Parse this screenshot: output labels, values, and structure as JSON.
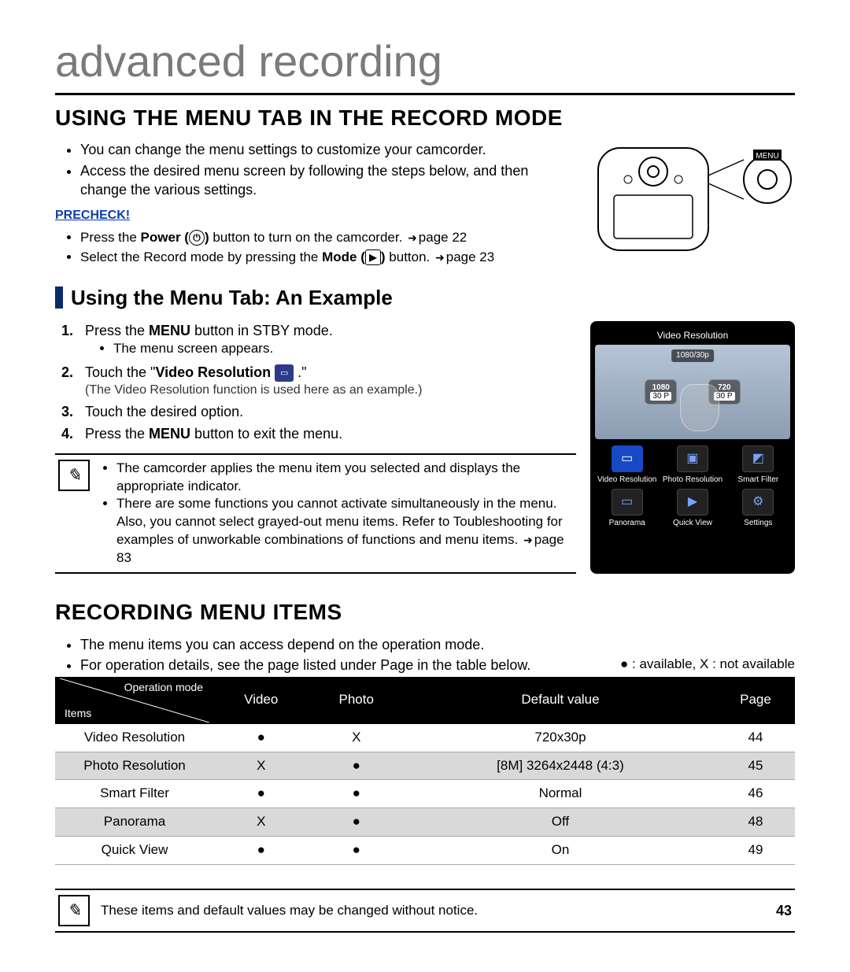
{
  "chapter_title": "advanced recording",
  "heading1": "USING THE MENU TAB IN THE RECORD MODE",
  "intro_bullets": [
    "You can change the menu settings to customize your camcorder.",
    "Access the desired menu screen by following the steps below, and then change the various settings."
  ],
  "precheck_label": "PRECHECK!",
  "precheck": {
    "line1_a": "Press the ",
    "line1_b": "Power (",
    "line1_c": ")",
    "line1_d": " button to turn on the camcorder. ",
    "line1_page": "page 22",
    "line2_a": "Select the Record mode by pressing the ",
    "line2_b": "Mode (",
    "line2_c": ")",
    "line2_d": " button. ",
    "line2_page": "page 23"
  },
  "camera_label": "MENU",
  "sub1": "Using the Menu Tab: An Example",
  "steps": {
    "s1_a": "Press the ",
    "s1_b": "MENU",
    "s1_c": " button in STBY mode.",
    "s1_sub": "The menu screen appears.",
    "s2_a": "Touch the \"",
    "s2_b": "Video Resolution",
    "s2_c": " .\"",
    "s2_note": "(The Video Resolution function is used here as an example.)",
    "s3": "Touch the desired option.",
    "s4_a": "Press the ",
    "s4_b": "MENU",
    "s4_c": " button to exit the menu."
  },
  "phone": {
    "title": "Video Resolution",
    "badge": "1080/30p",
    "opt1_top": "1080",
    "opt1_bot": "30 P",
    "opt2_top": "720",
    "opt2_bot": "30 P",
    "menu": [
      "Video Resolution",
      "Photo Resolution",
      "Smart Filter",
      "Panorama",
      "Quick View",
      "Settings"
    ]
  },
  "note1": [
    "The camcorder applies the menu item you selected and displays the appropriate indicator.",
    "There are some functions you cannot activate simultaneously in the menu. Also, you cannot select grayed-out menu items. Refer to Toubleshooting for examples of unworkable combinations of functions and menu items. "
  ],
  "note1_page": "page 83",
  "heading2": "RECORDING MENU ITEMS",
  "rec_bullets": [
    "The menu items you can access depend on the operation mode.",
    "For operation details, see the page listed under Page in the table below."
  ],
  "legend": "● : available, X : not available",
  "table": {
    "head_diag_top": "Operation mode",
    "head_diag_bottom": "Items",
    "cols": [
      "Video",
      "Photo",
      "Default value",
      "Page"
    ],
    "rows": [
      {
        "item": "Video Resolution",
        "video": "●",
        "photo": "X",
        "def": "720x30p",
        "page": "44"
      },
      {
        "item": "Photo Resolution",
        "video": "X",
        "photo": "●",
        "def": "[8M] 3264x2448 (4:3)",
        "page": "45"
      },
      {
        "item": "Smart Filter",
        "video": "●",
        "photo": "●",
        "def": "Normal",
        "page": "46"
      },
      {
        "item": "Panorama",
        "video": "X",
        "photo": "●",
        "def": "Off",
        "page": "48"
      },
      {
        "item": "Quick View",
        "video": "●",
        "photo": "●",
        "def": "On",
        "page": "49"
      }
    ]
  },
  "footer_note": "These items and default values may be changed without notice.",
  "page_number": "43"
}
